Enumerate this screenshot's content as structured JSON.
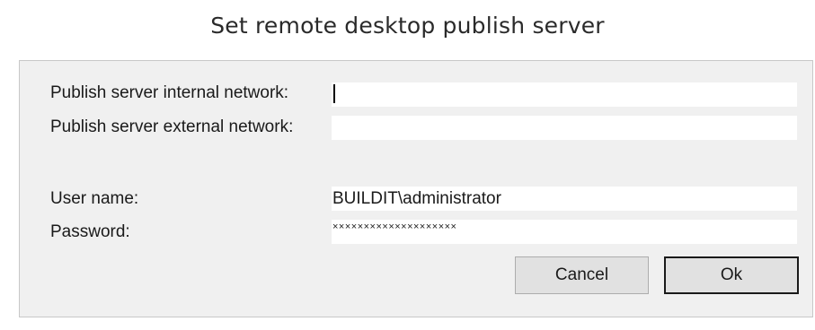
{
  "dialog": {
    "title": "Set remote desktop publish server"
  },
  "form": {
    "internal_network": {
      "label": "Publish server internal network:",
      "value": ""
    },
    "external_network": {
      "label": "Publish server external network:",
      "value": ""
    },
    "username": {
      "label": "User name:",
      "value": "BUILDIT\\administrator"
    },
    "password": {
      "label": "Password:",
      "value": "××××××××××××××××××××"
    }
  },
  "buttons": {
    "cancel_label": "Cancel",
    "ok_label": "Ok"
  }
}
